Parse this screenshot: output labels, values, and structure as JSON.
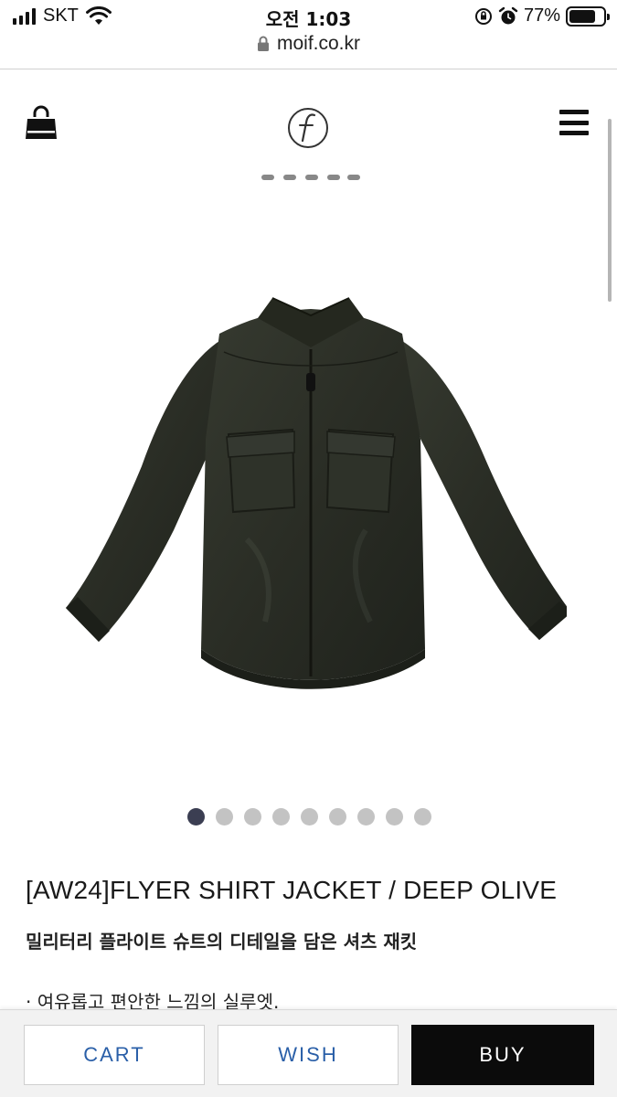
{
  "status_bar": {
    "carrier": "SKT",
    "time": "오전 1:03",
    "battery_percent": "77%",
    "battery_level": 0.77
  },
  "url_bar": {
    "domain": "moif.co.kr"
  },
  "header": {
    "cart_icon": "shopping-bag-icon",
    "logo_icon": "moif-logo-icon",
    "menu_icon": "hamburger-menu-icon"
  },
  "carousel": {
    "total": 9,
    "active_index": 0
  },
  "product": {
    "title": "[AW24]FLYER SHIRT JACKET / DEEP OLIVE",
    "subtitle": "밀리터리 플라이트 슈트의 디테일을 담은 셔츠 재킷",
    "description_line": "· 여유롭고 편안한 느낌의 실루엣."
  },
  "actions": {
    "cart_label": "CART",
    "wish_label": "WISH",
    "buy_label": "BUY"
  },
  "colors": {
    "accent": "#2a5fa8",
    "buy_bg": "#0b0b0b",
    "jacket": "#2b2e27",
    "dot_active": "#3b3e52",
    "dot_inactive": "#c3c3c3"
  }
}
